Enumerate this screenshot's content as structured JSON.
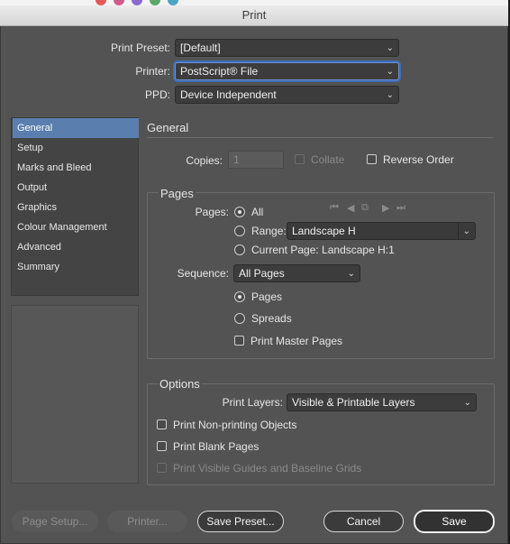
{
  "window": {
    "title": "Print"
  },
  "header": {
    "print_preset_label": "Print Preset:",
    "print_preset_value": "[Default]",
    "printer_label": "Printer:",
    "printer_value": "PostScript® File",
    "ppd_label": "PPD:",
    "ppd_value": "Device Independent"
  },
  "sidebar": {
    "items": [
      {
        "label": "General",
        "selected": true
      },
      {
        "label": "Setup"
      },
      {
        "label": "Marks and Bleed"
      },
      {
        "label": "Output"
      },
      {
        "label": "Graphics"
      },
      {
        "label": "Colour Management"
      },
      {
        "label": "Advanced"
      },
      {
        "label": "Summary"
      }
    ]
  },
  "general": {
    "title": "General",
    "copies_label": "Copies:",
    "copies_value": "1",
    "collate_label": "Collate",
    "reverse_order_label": "Reverse Order"
  },
  "pages": {
    "title": "Pages",
    "pages_label": "Pages:",
    "all_label": "All",
    "range_label": "Range:",
    "range_value": "Landscape H",
    "current_page_label": "Current Page: Landscape H:1",
    "sequence_label": "Sequence:",
    "sequence_value": "All Pages",
    "pages_option_label": "Pages",
    "spreads_label": "Spreads",
    "print_master_pages_label": "Print Master Pages",
    "selected_option": "All",
    "selected_layout": "Pages"
  },
  "options": {
    "title": "Options",
    "print_layers_label": "Print Layers:",
    "print_layers_value": "Visible & Printable Layers",
    "non_printing_label": "Print Non-printing Objects",
    "blank_pages_label": "Print Blank Pages",
    "guides_label": "Print Visible Guides and Baseline Grids"
  },
  "footer": {
    "page_setup_label": "Page Setup...",
    "printer_label": "Printer...",
    "save_preset_label": "Save Preset...",
    "cancel_label": "Cancel",
    "save_label": "Save"
  },
  "colors": {
    "panel_bg": "#535353",
    "selection": "#5a7fae",
    "focus_ring": "#3e6db5"
  }
}
